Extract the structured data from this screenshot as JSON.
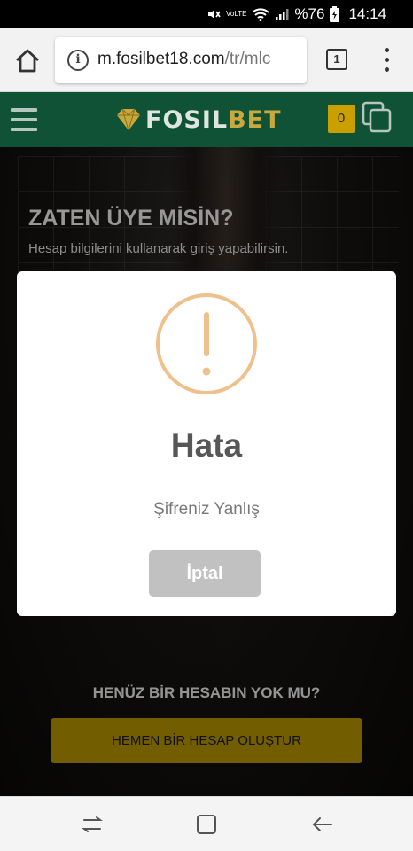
{
  "status_bar": {
    "network_label": "VoLTE",
    "battery": "%76",
    "time": "14:14",
    "icons": [
      "mute-icon",
      "volte-icon",
      "wifi-icon",
      "signal-icon",
      "battery-icon"
    ]
  },
  "browser": {
    "url_domain": "m.fosilbet18.com",
    "url_path": "/tr/mlc",
    "tab_count": "1",
    "icons": [
      "home-icon",
      "info-icon",
      "tabs-icon",
      "overflow-menu-icon"
    ]
  },
  "header": {
    "logo_part1": "FOSIL",
    "logo_part2": "BET",
    "cart_count": "0",
    "icons": [
      "hamburger-menu-icon",
      "diamond-logo-icon",
      "copy-icon"
    ]
  },
  "login": {
    "title": "ZATEN ÜYE MİSİN?",
    "subtitle": "Hesap bilgilerini kullanarak giriş yapabilirsin."
  },
  "register": {
    "prompt": "HENÜZ BİR HESABIN YOK MU?",
    "button_label": "HEMEN BİR HESAP OLUŞTUR"
  },
  "modal": {
    "icon": "warning-icon",
    "title": "Hata",
    "message": "Şifreniz Yanlış",
    "cancel_label": "İptal",
    "icon_color": "#f0c08c",
    "button_color": "#c1c1c1"
  },
  "colors": {
    "header_bg": "#0f5236",
    "brand_gold": "#c9a000",
    "cta_gold": "#b09000"
  },
  "nav_bar": {
    "icons": [
      "recents-icon",
      "home-square-icon",
      "back-icon"
    ]
  }
}
